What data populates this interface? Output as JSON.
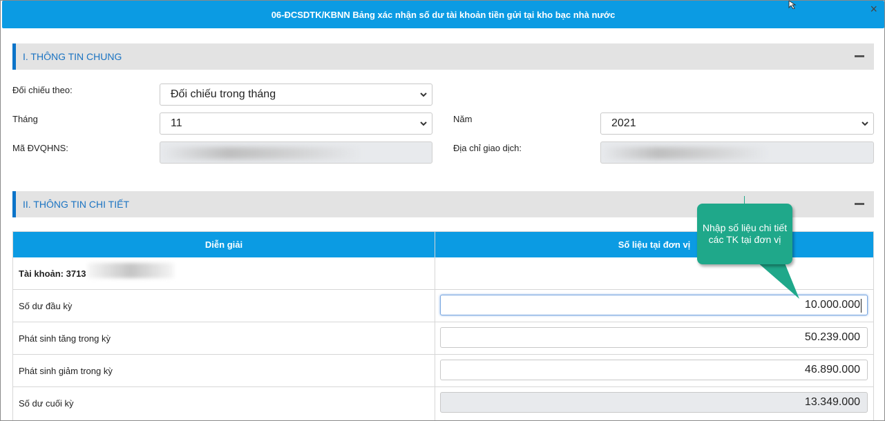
{
  "window": {
    "title": "06-ĐCSDTK/KBNN Bảng xác nhận số dư tài khoản tiền gửi tại kho bạc nhà nước",
    "close_label": "×"
  },
  "section1": {
    "title": "I. THÔNG TIN CHUNG",
    "compare_by_label": "Đối chiếu theo:",
    "compare_by_value": "Đối chiếu trong tháng",
    "month_label": "Tháng",
    "month_value": "11",
    "year_label": "Năm",
    "year_value": "2021",
    "unit_code_label": "Mã ĐVQHNS:",
    "address_label": "Địa chỉ giao dịch:"
  },
  "section2": {
    "title": "II. THÔNG TIN CHI TIẾT",
    "table": {
      "col_description": "Diễn giải",
      "col_unit_value": "Số liệu tại đơn vị",
      "account_label": "Tài khoản: 3713",
      "rows": [
        {
          "label": "Số dư đầu kỳ",
          "value": "10.000.000"
        },
        {
          "label": "Phát sinh tăng trong kỳ",
          "value": "50.239.000"
        },
        {
          "label": "Phát sinh giảm trong kỳ",
          "value": "46.890.000"
        },
        {
          "label": "Số dư cuối kỳ",
          "value": "13.349.000"
        }
      ]
    }
  },
  "tooltip": {
    "text": "Nhập số liệu chi tiết các TK tại đơn vị"
  },
  "colors": {
    "accent": "#0b9be3",
    "section_bar": "#0b74c9",
    "tooltip": "#1fa88a"
  }
}
